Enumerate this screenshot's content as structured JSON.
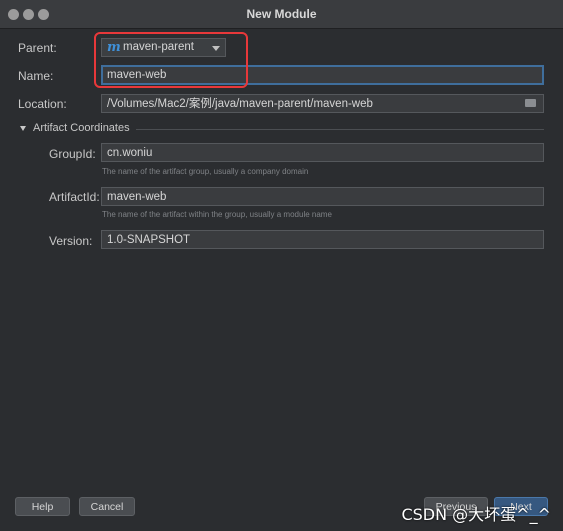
{
  "window": {
    "title": "New Module"
  },
  "form": {
    "parent_label": "Parent:",
    "parent_value": "maven-parent",
    "parent_icon": "m",
    "name_label": "Name:",
    "name_value": "maven-web",
    "location_label": "Location:",
    "location_value": "/Volumes/Mac2/案例/java/maven-parent/maven-web"
  },
  "artifact": {
    "section_title": "Artifact Coordinates",
    "groupid_label": "GroupId:",
    "groupid_value": "cn.woniu",
    "groupid_hint": "The name of the artifact group, usually a company domain",
    "artifactid_label": "ArtifactId:",
    "artifactid_value": "maven-web",
    "artifactid_hint": "The name of the artifact within the group, usually a module name",
    "version_label": "Version:",
    "version_value": "1.0-SNAPSHOT"
  },
  "footer": {
    "help": "Help",
    "cancel": "Cancel",
    "previous": "Previous",
    "next": "Next"
  },
  "watermark": "CSDN @大坏蛋^_^",
  "colors": {
    "highlight": "#e8383a",
    "accent": "#365880",
    "background": "#2b2d30"
  }
}
